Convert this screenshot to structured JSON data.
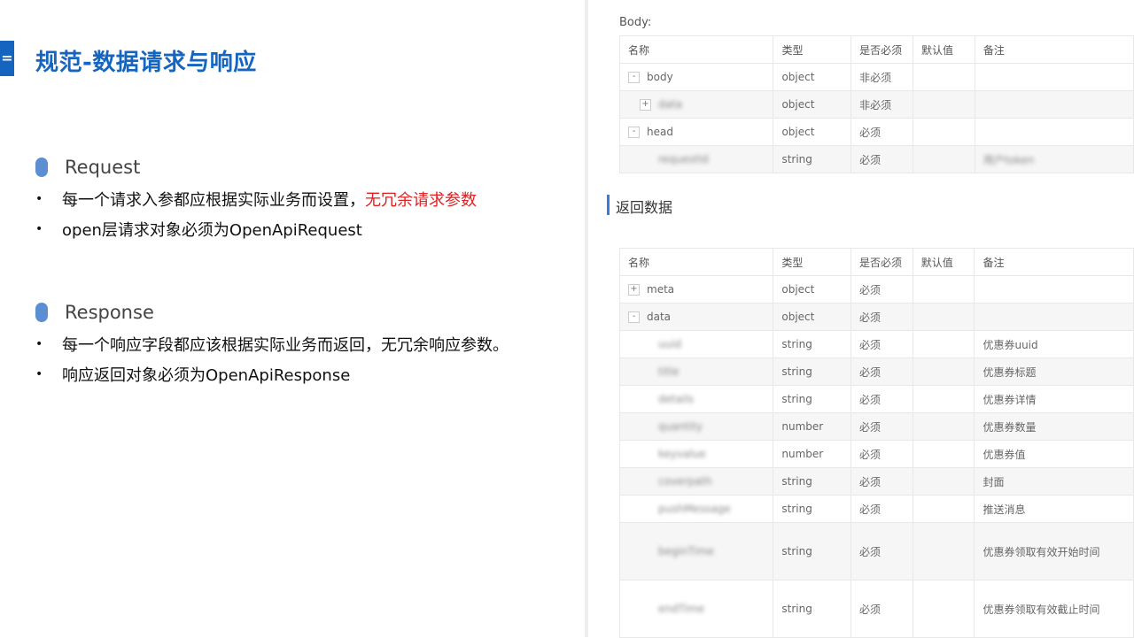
{
  "slide": {
    "title_mark": "=",
    "title": "规范-数据请求与响应",
    "request": {
      "title": "Request",
      "bullets": [
        {
          "text": "每一个请求入参都应根据实际业务而设置，",
          "highlight": "无冗余请求参数"
        },
        {
          "text": "open层请求对象必须为OpenApiRequest",
          "highlight": ""
        }
      ]
    },
    "response": {
      "title": "Response",
      "bullets": [
        {
          "text": "每一个响应字段都应该根据实际业务而返回，无冗余响应参数。"
        },
        {
          "text": "响应返回对象必须为OpenApiResponse"
        }
      ]
    },
    "highlight_color": "#e02020",
    "accent_color": "#1565c0"
  },
  "doc": {
    "body_label": "Body:",
    "return_label": "返回数据",
    "headers": [
      "名称",
      "类型",
      "是否必须",
      "默认值",
      "备注"
    ],
    "body_rows": [
      {
        "toggle": "-",
        "name": "body",
        "type": "object",
        "required": "非必须",
        "default": "",
        "note": ""
      },
      {
        "toggle": "+",
        "name": "data",
        "type": "object",
        "required": "非必须",
        "default": "",
        "note": ""
      },
      {
        "toggle": "-",
        "name": "head",
        "type": "object",
        "required": "必须",
        "default": "",
        "note": ""
      },
      {
        "toggle": "",
        "name": "requestId",
        "type": "string",
        "required": "必须",
        "default": "",
        "note": "用户token"
      }
    ],
    "return_rows": [
      {
        "toggle": "+",
        "name": "meta",
        "type": "object",
        "required": "必须",
        "default": "",
        "note": ""
      },
      {
        "toggle": "-",
        "name": "data",
        "type": "object",
        "required": "必须",
        "default": "",
        "note": ""
      },
      {
        "toggle": "",
        "name": "uuid",
        "type": "string",
        "required": "必须",
        "default": "",
        "note": "优惠券uuid"
      },
      {
        "toggle": "",
        "name": "title",
        "type": "string",
        "required": "必须",
        "default": "",
        "note": "优惠券标题"
      },
      {
        "toggle": "",
        "name": "details",
        "type": "string",
        "required": "必须",
        "default": "",
        "note": "优惠券详情"
      },
      {
        "toggle": "",
        "name": "quantity",
        "type": "number",
        "required": "必须",
        "default": "",
        "note": "优惠券数量"
      },
      {
        "toggle": "",
        "name": "keyvalue",
        "type": "number",
        "required": "必须",
        "default": "",
        "note": "优惠券值"
      },
      {
        "toggle": "",
        "name": "coverpath",
        "type": "string",
        "required": "必须",
        "default": "",
        "note": "封面"
      },
      {
        "toggle": "",
        "name": "pushMessage",
        "type": "string",
        "required": "必须",
        "default": "",
        "note": "推送消息"
      },
      {
        "toggle": "",
        "name": "beginTime",
        "type": "string",
        "required": "必须",
        "default": "",
        "note": "优惠券领取有效开始时间"
      },
      {
        "toggle": "",
        "name": "endTime",
        "type": "string",
        "required": "必须",
        "default": "",
        "note": "优惠券领取有效截止时间"
      }
    ]
  }
}
